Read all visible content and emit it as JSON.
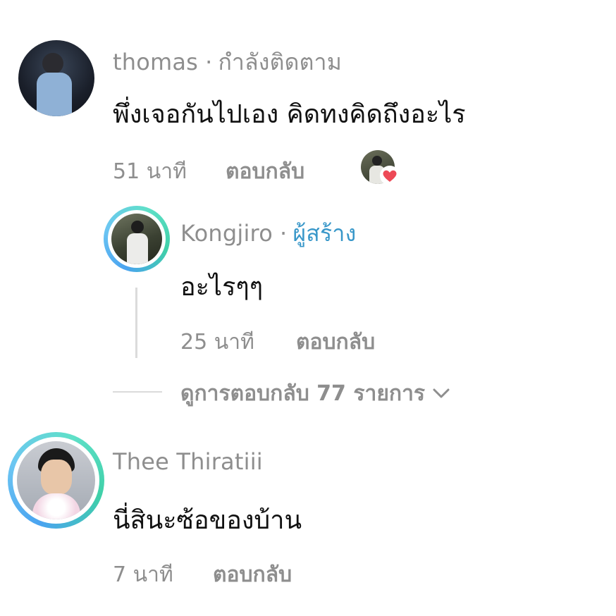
{
  "comments": [
    {
      "username": "thomas",
      "separator": "·",
      "status": "กำลังติดตาม",
      "text": "พึ่งเจอกันไปเอง คิดทงคิดถึงอะไร",
      "time": "51 นาที",
      "reply_label": "ตอบกลับ"
    },
    {
      "username": "Kongjiro",
      "separator": "·",
      "status": "ผู้สร้าง",
      "text": "อะไรๆๆ",
      "time": "25 นาที",
      "reply_label": "ตอบกลับ"
    },
    {
      "username": "Thee Thiratiii",
      "text": "นี่สินะซ้อของบ้าน",
      "time": "7 นาที",
      "reply_label": "ตอบกลับ"
    }
  ],
  "view_replies": "ดูการตอบกลับ 77 รายการ",
  "colors": {
    "creator_badge": "#3897c9",
    "heart": "#ed4956",
    "muted_text": "#8e8e8e"
  },
  "icons": {
    "liked_by_creator": "heart-icon",
    "expand": "chevron-down-icon"
  }
}
